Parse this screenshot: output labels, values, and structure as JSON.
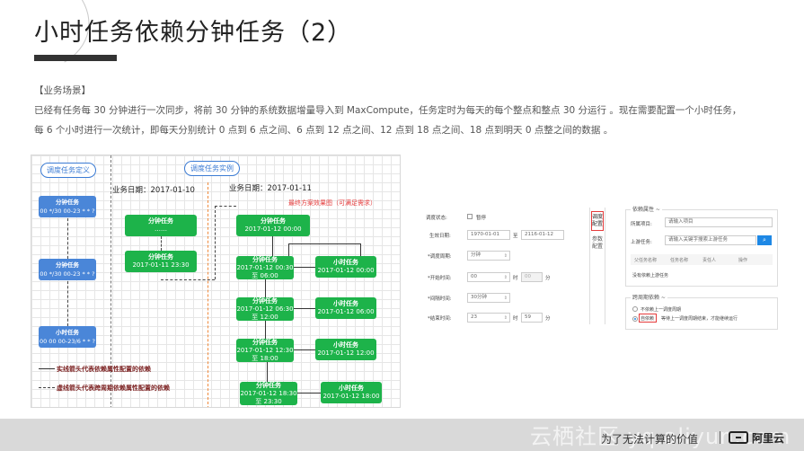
{
  "slide": {
    "title": "小时任务依赖分钟任务（2）",
    "section_label": "【业务场景】",
    "paragraph_line1": "已经有任务每 30 分钟进行一次同步，将前 30 分钟的系统数据增量导入到 MaxCompute，任务定时为每天的每个整点和整点 30 分运行 。现在需要配置一个小时任务，",
    "paragraph_line2": "每 6 个小时进行一次统计，即每天分别统计 0 点到 6 点之间、6 点到 12 点之间、12 点到 18 点之间、18 点到明天 0 点整之间的数据 。"
  },
  "diagram": {
    "definition_label": "调度任务定义",
    "instance_label": "调度任务实例",
    "date1": "业务日期：2017-01-10",
    "date2": "业务日期：2017-01-11",
    "red_note": "最终方案效果图（可满足需求）",
    "defs": [
      {
        "title": "分钟任务",
        "cron": "00 */30 00-23 * * ?"
      },
      {
        "title": "分钟任务",
        "cron": "00 */30 00-23 * * ?"
      },
      {
        "title": "小时任务",
        "cron": "00 00 00-23/6 * * ?"
      }
    ],
    "day1": [
      {
        "title": "分钟任务",
        "time": "……"
      },
      {
        "title": "分钟任务",
        "time": "2017-01-11 23:30"
      }
    ],
    "day2_minute": [
      {
        "title": "分钟任务",
        "time": "2017-01-12 00:00"
      },
      {
        "title": "分钟任务",
        "time": "2017-01-12 00:30至 06:00"
      },
      {
        "title": "分钟任务",
        "time": "2017-01-12 06:30至 12:00"
      },
      {
        "title": "分钟任务",
        "time": "2017-01-12 12:30至 18:00"
      },
      {
        "title": "分钟任务",
        "time": "2017-01-12 18:30至 23:30"
      }
    ],
    "day2_hour": [
      {
        "title": "小时任务",
        "time": "2017-01-12 00:00"
      },
      {
        "title": "小时任务",
        "time": "2017-01-12 06:00"
      },
      {
        "title": "小时任务",
        "time": "2017-01-12 12:00"
      },
      {
        "title": "小时任务",
        "time": "2017-01-12 18:00"
      }
    ],
    "legend_solid": "实线箭头代表依赖属性配置的依赖",
    "legend_dashed": "虚线箭头代表跨周期依赖属性配置的依赖"
  },
  "config": {
    "status_label": "调度状态:",
    "status_checkbox": "暂停",
    "date_label": "生效日期:",
    "date_from": "1970-01-01",
    "date_to_label": "至",
    "date_to": "2116-01-12",
    "period_label": "*调度周期:",
    "period_value": "分钟",
    "start_label": "*开始时间:",
    "start_hour": "00",
    "hour_unit": "时",
    "start_min": "00",
    "min_unit": "分",
    "interval_label": "*间隔时间:",
    "interval_value": "30分钟",
    "end_label": "*结束时间:",
    "end_hour": "23",
    "end_min": "59",
    "tab_schedule": "调度配置",
    "tab_params": "参数配置",
    "dep_group": "依赖属性 ~",
    "project_label": "所属项目:",
    "project_placeholder": "请输入项目",
    "upstream_label": "上游任务:",
    "upstream_placeholder": "请输入关键字搜索上游任务",
    "col_task_name": "任务名称",
    "col_owner": "责任人",
    "col_action": "操作",
    "col_parent": "父任务名称",
    "empty_text": "没有依赖上游任务",
    "cross_group": "跨周期依赖 ~",
    "opt_none": "不依赖上一调度周期",
    "opt_self": "自依赖",
    "opt_self_desc": "等待上一调度周期结束，才能继续运行"
  },
  "footer": {
    "watermark": "云栖社区 yq.aliyun.com",
    "slogan": "为了无法计算的价值",
    "logo_text": "阿里云"
  }
}
